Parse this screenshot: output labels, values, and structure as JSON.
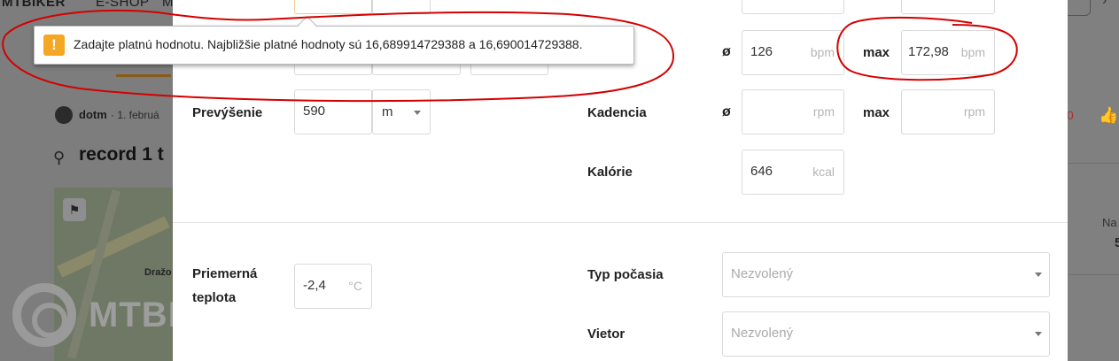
{
  "background": {
    "nav": [
      "MTBIKER",
      "E-SHOP",
      "M"
    ],
    "user": "dotm",
    "date": "· 1. februá",
    "title": "record 1 t",
    "map_label": "Dražo",
    "logo_text": "MTBIKER",
    "right_na": "Na",
    "right_num": "5",
    "right_red": "0"
  },
  "tooltip": {
    "text": "Zadajte platnú hodnotu. Najbližšie platné hodnoty sú 16,689914729388 a 16,690014729388.",
    "icon": "warning-icon"
  },
  "form": {
    "elevation": {
      "label": "Prevýšenie",
      "value": "590",
      "unit": "m"
    },
    "heart_rate": {
      "avg_symbol": "ø",
      "avg_value": "126",
      "avg_unit": "bpm",
      "max_label": "max",
      "max_value": "172,98",
      "max_unit": "bpm"
    },
    "cadence": {
      "label": "Kadencia",
      "avg_symbol": "ø",
      "avg_unit": "rpm",
      "max_label": "max",
      "max_unit": "rpm"
    },
    "calories": {
      "label": "Kalórie",
      "value": "646",
      "unit": "kcal"
    },
    "temperature": {
      "label_line1": "Priemerná",
      "label_line2": "teplota",
      "value": "-2,4",
      "unit": "°C"
    },
    "weather": {
      "label": "Typ počasia",
      "placeholder": "Nezvolený"
    },
    "wind": {
      "label": "Vietor",
      "placeholder": "Nezvolený"
    }
  },
  "colors": {
    "annotation": "#d40000",
    "warning": "#f5a623",
    "accent": "#8a5a17"
  }
}
